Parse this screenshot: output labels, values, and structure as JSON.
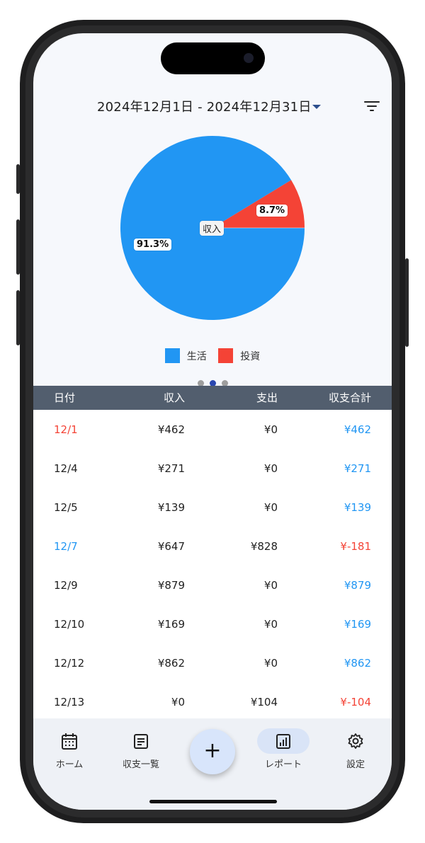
{
  "header": {
    "date_range": "2024年12月1日 - 2024年12月31日",
    "caret_icon": "dropdown-caret-icon",
    "filter_icon": "filter-icon"
  },
  "chart_data": {
    "type": "pie",
    "center_label": "収入",
    "slices": [
      {
        "name": "生活",
        "value": 91.3,
        "label": "91.3%",
        "color": "#2196f3"
      },
      {
        "name": "投資",
        "value": 8.7,
        "label": "8.7%",
        "color": "#f44336"
      }
    ],
    "legend_position": "bottom"
  },
  "legend": [
    {
      "label": "生活",
      "color": "#2196f3"
    },
    {
      "label": "投資",
      "color": "#f44336"
    }
  ],
  "pager": {
    "count": 3,
    "active": 2
  },
  "table": {
    "headers": [
      "日付",
      "収入",
      "支出",
      "収支合計"
    ],
    "rows": [
      {
        "date": "12/1",
        "date_color": "#f44336",
        "income": "¥462",
        "expense": "¥0",
        "total": "¥462",
        "total_color": "#2196f3"
      },
      {
        "date": "12/4",
        "date_color": "#222222",
        "income": "¥271",
        "expense": "¥0",
        "total": "¥271",
        "total_color": "#2196f3"
      },
      {
        "date": "12/5",
        "date_color": "#222222",
        "income": "¥139",
        "expense": "¥0",
        "total": "¥139",
        "total_color": "#2196f3"
      },
      {
        "date": "12/7",
        "date_color": "#2196f3",
        "income": "¥647",
        "expense": "¥828",
        "total": "¥-181",
        "total_color": "#f44336"
      },
      {
        "date": "12/9",
        "date_color": "#222222",
        "income": "¥879",
        "expense": "¥0",
        "total": "¥879",
        "total_color": "#2196f3"
      },
      {
        "date": "12/10",
        "date_color": "#222222",
        "income": "¥169",
        "expense": "¥0",
        "total": "¥169",
        "total_color": "#2196f3"
      },
      {
        "date": "12/12",
        "date_color": "#222222",
        "income": "¥862",
        "expense": "¥0",
        "total": "¥862",
        "total_color": "#2196f3"
      },
      {
        "date": "12/13",
        "date_color": "#222222",
        "income": "¥0",
        "expense": "¥104",
        "total": "¥-104",
        "total_color": "#f44336"
      }
    ]
  },
  "nav": {
    "home": {
      "label": "ホーム",
      "icon": "calendar-icon"
    },
    "list": {
      "label": "収支一覧",
      "icon": "list-icon"
    },
    "add": {
      "label": "+",
      "icon": "plus-icon"
    },
    "report": {
      "label": "レポート",
      "icon": "report-chart-icon"
    },
    "settings": {
      "label": "設定",
      "icon": "gear-icon"
    }
  }
}
